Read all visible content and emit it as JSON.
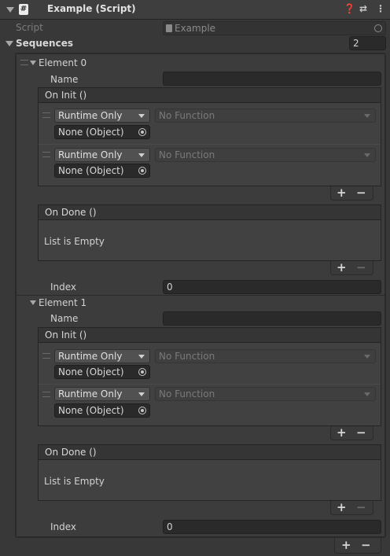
{
  "component": {
    "title": "Example (Script)",
    "icon_glyph": "#",
    "header_icons": [
      "help-icon",
      "settings-sliders-icon",
      "more-vertical-icon"
    ],
    "help_glyph": "❓",
    "preset_glyph": "⇄",
    "more_glyph": "⋮"
  },
  "script_row": {
    "label": "Script",
    "value": "Example"
  },
  "sequences": {
    "label": "Sequences",
    "count": "2",
    "elements": [
      {
        "label": "Element 0",
        "name_label": "Name",
        "name_value": "",
        "on_init": {
          "label": "On Init ()",
          "listeners": [
            {
              "mode": "Runtime Only",
              "function": "No Function",
              "object": "None (Object)"
            },
            {
              "mode": "Runtime Only",
              "function": "No Function",
              "object": "None (Object)"
            }
          ]
        },
        "on_done": {
          "label": "On Done ()",
          "empty_text": "List is Empty"
        },
        "index_label": "Index",
        "index_value": "0"
      },
      {
        "label": "Element 1",
        "name_label": "Name",
        "name_value": "",
        "on_init": {
          "label": "On Init ()",
          "listeners": [
            {
              "mode": "Runtime Only",
              "function": "No Function",
              "object": "None (Object)"
            },
            {
              "mode": "Runtime Only",
              "function": "No Function",
              "object": "None (Object)"
            }
          ]
        },
        "on_done": {
          "label": "On Done ()",
          "empty_text": "List is Empty"
        },
        "index_label": "Index",
        "index_value": "0"
      }
    ]
  },
  "buttons": {
    "plus": "+",
    "minus": "−"
  }
}
